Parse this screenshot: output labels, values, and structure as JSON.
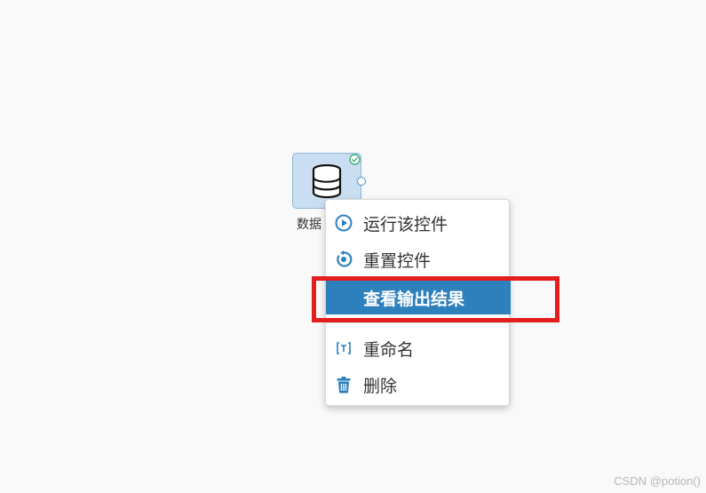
{
  "node": {
    "label": "数据",
    "icon": "database-icon",
    "status_icon": "check-circle-icon",
    "status_color": "#3cb371"
  },
  "context_menu": {
    "items": [
      {
        "label": "运行该控件",
        "icon": "play-circle-icon"
      },
      {
        "label": "重置控件",
        "icon": "reset-icon"
      },
      {
        "label": "查看输出结果",
        "icon": "",
        "highlighted": true
      },
      {
        "label": "重命名",
        "icon": "rename-icon"
      },
      {
        "label": "删除",
        "icon": "trash-icon"
      }
    ]
  },
  "colors": {
    "accent": "#2e80bd",
    "annotation": "#e41e1e",
    "node_fill": "#c9dff1"
  },
  "watermark": "CSDN @potion()"
}
